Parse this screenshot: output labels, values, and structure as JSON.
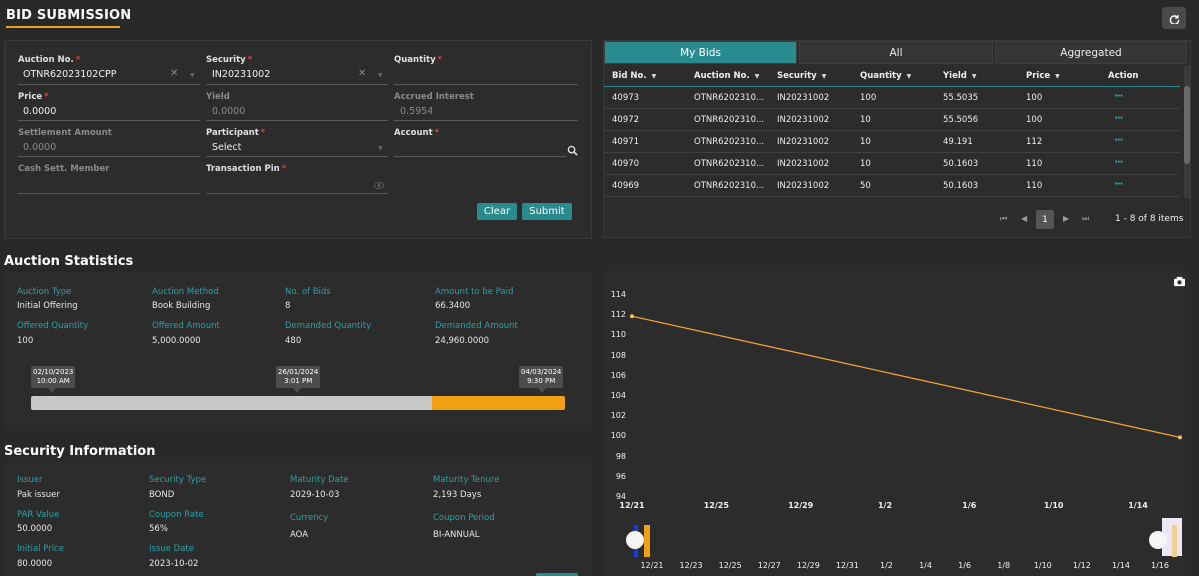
{
  "page_title": "BID SUBMISSION",
  "form": {
    "auction_no": {
      "label": "Auction No.",
      "value": "OTNR62023102CPP"
    },
    "security": {
      "label": "Security",
      "value": "IN20231002"
    },
    "quantity": {
      "label": "Quantity",
      "value": ""
    },
    "price": {
      "label": "Price",
      "value": "0.0000"
    },
    "yield": {
      "label": "Yield",
      "value": "0.0000"
    },
    "accrued_interest": {
      "label": "Accrued Interest",
      "value": "0.5954"
    },
    "settlement_amount": {
      "label": "Settlement Amount",
      "value": "0.0000"
    },
    "participant": {
      "label": "Participant",
      "value": "Select"
    },
    "account": {
      "label": "Account",
      "value": ""
    },
    "cash_sett_member": {
      "label": "Cash Sett. Member",
      "value": ""
    },
    "transaction_pin": {
      "label": "Transaction Pin",
      "value": ""
    },
    "required_mark": "*",
    "clear_label": "Clear",
    "submit_label": "Submit"
  },
  "bids": {
    "tabs": [
      "My Bids",
      "All",
      "Aggregated"
    ],
    "active_tab": "My Bids",
    "columns": [
      "Bid No.",
      "Auction No.",
      "Security",
      "Quantity",
      "Yield",
      "Price",
      "Action"
    ],
    "rows": [
      {
        "bid_no": "40973",
        "auction_no": "OTNR6202310...",
        "security": "IN20231002",
        "quantity": "100",
        "yield": "55.5035",
        "price": "100",
        "action": "···"
      },
      {
        "bid_no": "40972",
        "auction_no": "OTNR6202310...",
        "security": "IN20231002",
        "quantity": "10",
        "yield": "55.5056",
        "price": "100",
        "action": "···"
      },
      {
        "bid_no": "40971",
        "auction_no": "OTNR6202310...",
        "security": "IN20231002",
        "quantity": "10",
        "yield": "49.191",
        "price": "112",
        "action": "···"
      },
      {
        "bid_no": "40970",
        "auction_no": "OTNR6202310...",
        "security": "IN20231002",
        "quantity": "10",
        "yield": "50.1603",
        "price": "110",
        "action": "···"
      },
      {
        "bid_no": "40969",
        "auction_no": "OTNR6202310...",
        "security": "IN20231002",
        "quantity": "50",
        "yield": "50.1603",
        "price": "110",
        "action": "···"
      }
    ],
    "pager": {
      "current_page": "1",
      "summary": "1 - 8 of 8 items"
    }
  },
  "auction_stats": {
    "title": "Auction Statistics",
    "fields": [
      {
        "label": "Auction Type",
        "value": "Initial Offering"
      },
      {
        "label": "Auction Method",
        "value": "Book Building"
      },
      {
        "label": "No. of Bids",
        "value": "8"
      },
      {
        "label": "Amount to be Paid",
        "value": "66.3400"
      },
      {
        "label": "Offered Quantity",
        "value": "100"
      },
      {
        "label": "Offered Amount",
        "value": "5,000.0000"
      },
      {
        "label": "Demanded Quantity",
        "value": "480"
      },
      {
        "label": "Demanded Amount",
        "value": "24,960.0000"
      }
    ],
    "timeline": {
      "start": {
        "date": "02/10/2023",
        "time": "10:00 AM"
      },
      "current": {
        "date": "26/01/2024",
        "time": "3:01 PM"
      },
      "end": {
        "date": "04/03/2024",
        "time": "9:30 PM"
      },
      "elapsed_fraction": 0.75,
      "elapsed_color": "#c8c8c8",
      "remaining_color": "#f0a010"
    }
  },
  "security_info": {
    "title": "Security Information",
    "fields": [
      {
        "label": "Issuer",
        "value": "Pak issuer"
      },
      {
        "label": "Security Type",
        "value": "BOND"
      },
      {
        "label": "Maturity Date",
        "value": "2029-10-03"
      },
      {
        "label": "Maturity Tenure",
        "value": "2,193 Days"
      },
      {
        "label": "PAR Value",
        "value": "50.0000"
      },
      {
        "label": "Coupon Rate",
        "value": "56%"
      },
      {
        "label": "Currency",
        "value": "AOA"
      },
      {
        "label": "Coupon Period",
        "value": "BI-ANNUAL"
      },
      {
        "label": "Initial Price",
        "value": "80.0000"
      },
      {
        "label": "Issue Date",
        "value": "2023-10-02"
      }
    ]
  },
  "chart_data": {
    "type": "line",
    "y_ticks": [
      "114",
      "112",
      "110",
      "108",
      "106",
      "104",
      "102",
      "100",
      "98",
      "96",
      "94"
    ],
    "ylim": [
      94,
      115
    ],
    "x_ticks": [
      "12/21",
      "12/25",
      "12/29",
      "1/2",
      "1/6",
      "1/10",
      "1/14"
    ],
    "navigator_ticks": [
      "12/21",
      "12/23",
      "12/25",
      "12/27",
      "12/29",
      "12/31",
      "1/2",
      "1/4",
      "1/6",
      "1/8",
      "1/10",
      "1/12",
      "1/14",
      "1/16"
    ],
    "points": [
      {
        "x": "2023-12-21",
        "y": 112
      },
      {
        "x": "2024-01-17",
        "y": 100
      }
    ],
    "line_color": "#f0a030"
  },
  "icons": {
    "refresh": "refresh-icon",
    "search": "search-icon",
    "camera": "camera-icon",
    "eye": "eye-icon"
  },
  "colors": {
    "accent": "#2a8b8f",
    "label_teal": "#2aa0a5",
    "underline_orange": "#e8a020"
  }
}
